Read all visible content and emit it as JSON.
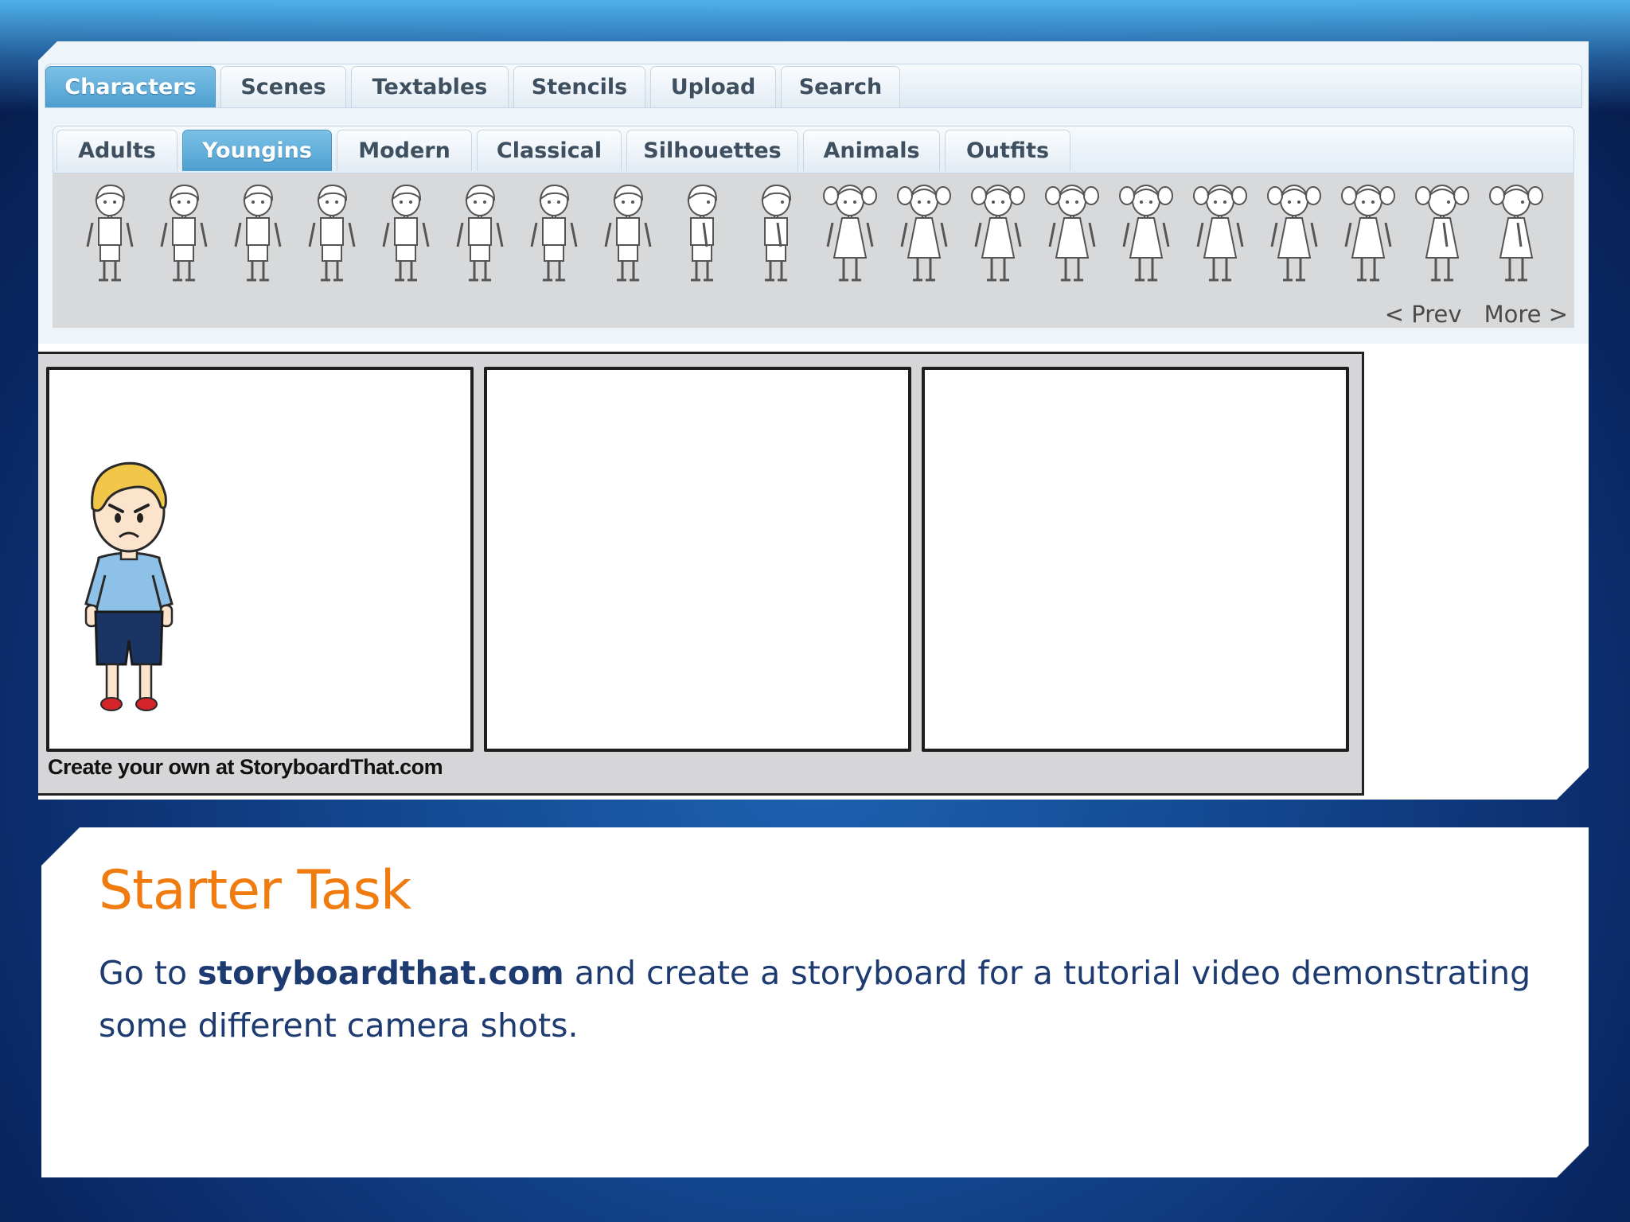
{
  "app": {
    "main_tabs": [
      {
        "label": "Characters",
        "active": true
      },
      {
        "label": "Scenes",
        "active": false
      },
      {
        "label": "Textables",
        "active": false
      },
      {
        "label": "Stencils",
        "active": false
      },
      {
        "label": "Upload",
        "active": false
      },
      {
        "label": "Search",
        "active": false
      }
    ],
    "sub_tabs": [
      {
        "label": "Adults",
        "active": false
      },
      {
        "label": "Youngins",
        "active": true
      },
      {
        "label": "Modern",
        "active": false
      },
      {
        "label": "Classical",
        "active": false
      },
      {
        "label": "Silhouettes",
        "active": false
      },
      {
        "label": "Animals",
        "active": false
      },
      {
        "label": "Outfits",
        "active": false
      }
    ],
    "pager": {
      "prev": "< Prev",
      "more": "More >"
    },
    "storyboard": {
      "credit": "Create your own at StoryboardThat.com"
    },
    "colors": {
      "active_tab": "#5aa9d6",
      "palette_bg": "#d8d9db",
      "board_bg": "#d6d6d8"
    }
  },
  "task": {
    "title": "Starter Task",
    "text_before": "Go to ",
    "link": "storyboardthat.com",
    "text_after": " and create a storyboard for a tutorial video demonstrating some different camera shots.",
    "title_color": "#f07c10",
    "text_color": "#1d3b70"
  }
}
